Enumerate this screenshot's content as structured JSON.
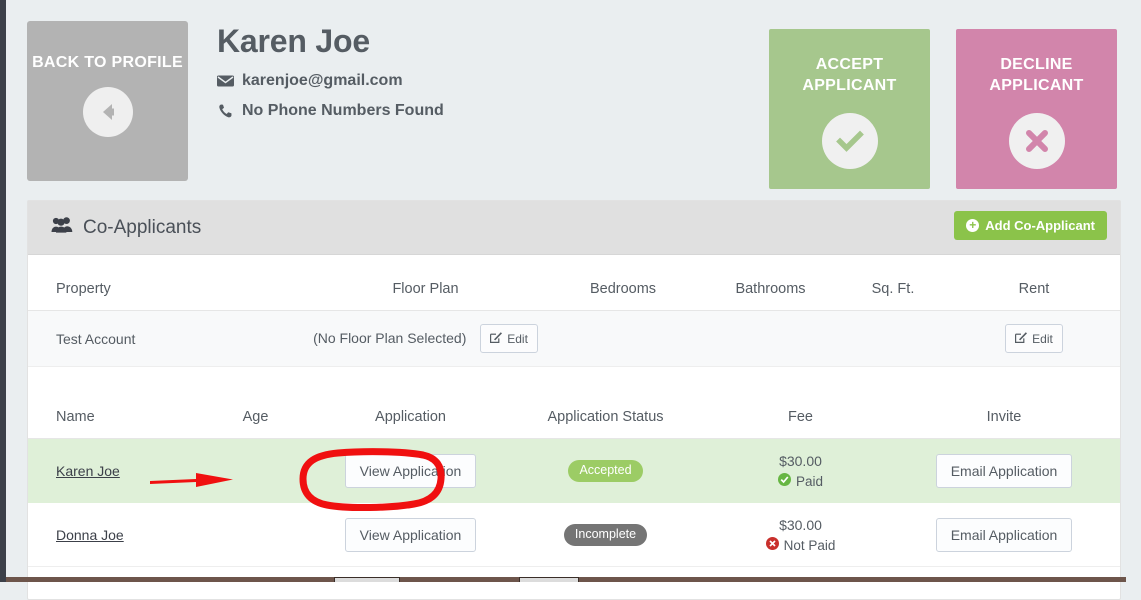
{
  "header": {
    "back_button": {
      "label": "BACK TO PROFILE",
      "icon": "arrow-left-circle-icon"
    },
    "applicant_name": "Karen Joe",
    "email": "karenjoe@gmail.com",
    "email_icon": "envelope-icon",
    "phone": "No Phone Numbers Found",
    "phone_icon": "phone-icon",
    "accept_button": {
      "label": "ACCEPT APPLICANT",
      "icon": "check-circle-icon",
      "color": "#a6c78d"
    },
    "decline_button": {
      "label": "DECLINE APPLICANT",
      "icon": "x-circle-icon",
      "color": "#d285ab"
    }
  },
  "card": {
    "title": "Co-Applicants",
    "title_icon": "users-icon",
    "add_button": {
      "label": "Add Co-Applicant",
      "icon": "plus-circle-icon",
      "color": "#8bc34a"
    }
  },
  "property_table": {
    "columns": [
      "Property",
      "Floor Plan",
      "Bedrooms",
      "Bathrooms",
      "Sq. Ft.",
      "Rent"
    ],
    "rows": [
      {
        "property": "Test Account",
        "floor_plan": "(No Floor Plan Selected)",
        "floor_plan_edit": "Edit",
        "bedrooms": "",
        "bathrooms": "",
        "sq_ft": "",
        "rent_edit": "Edit",
        "edit_icon": "pencil-square-icon"
      }
    ]
  },
  "applicants_table": {
    "columns": [
      "Name",
      "Age",
      "Application",
      "Application Status",
      "Fee",
      "Invite"
    ],
    "rows": [
      {
        "name": "Karen Joe",
        "age": "",
        "application_button": "View Application",
        "status": "Accepted",
        "status_color": "#9ccc65",
        "fee": "$30.00",
        "fee_status": "Paid",
        "fee_status_icon": "check-circle-icon",
        "invite_button": "Email Application",
        "highlighted": true
      },
      {
        "name": "Donna Joe",
        "age": "",
        "application_button": "View Application",
        "status": "Incomplete",
        "status_color": "#757575",
        "fee": "$30.00",
        "fee_status": "Not Paid",
        "fee_status_icon": "x-circle-icon",
        "invite_button": "Email Application",
        "highlighted": false
      }
    ]
  },
  "annotations": {
    "color": "#f01010",
    "arrow": "red-arrow-pointing-right",
    "highlight_circle": "red-circle-around-view-application"
  }
}
